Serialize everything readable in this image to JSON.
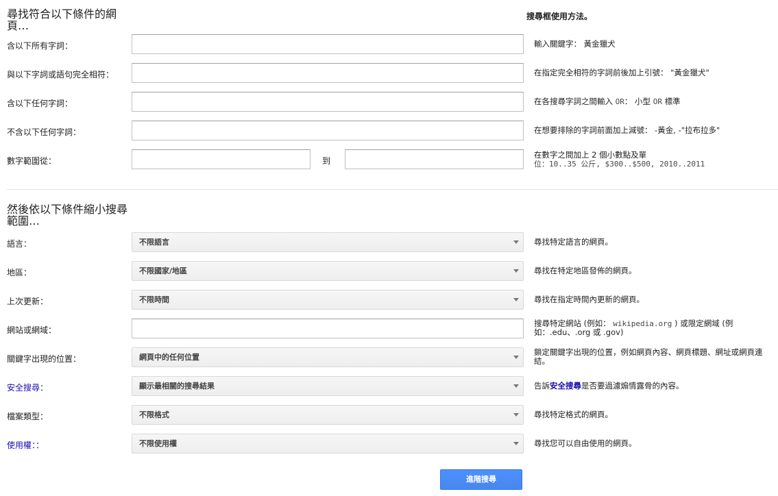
{
  "section1": {
    "title_line1": "尋找符合以下條件的網",
    "title_line2": "頁…",
    "help_header": "搜尋框使用方法。",
    "rows": [
      {
        "label": "含以下所有字詞：",
        "help": "輸入關鍵字： 黃金獵犬",
        "value": ""
      },
      {
        "label": "與以下字詞或語句完全相符：",
        "help": "在指定完全相符的字詞前後加上引號： \"黃金獵犬\"",
        "value": ""
      },
      {
        "label": "含以下任何字詞：",
        "help_prefix": "在各搜尋字詞之間輸入 ",
        "help_or1": "OR",
        "help_mid": "： 小型 ",
        "help_or2": "OR",
        "help_end": " 標準",
        "value": ""
      },
      {
        "label": "不含以下任何字詞：",
        "help": "在想要排除的字詞前面加上減號： -黃金, -\"拉布拉多\"",
        "value": ""
      }
    ],
    "range": {
      "label": "數字範圍從：",
      "to_label": "到",
      "from_value": "",
      "to_value": "",
      "help_line1": "在數字之間加上 2 個小數點及單",
      "help_line2": "位：10..35 公斤, $300..$500, 2010..2011"
    }
  },
  "section2": {
    "title_line1": "然後依以下條件縮小搜尋",
    "title_line2": "範圍…",
    "rows": [
      {
        "label": "語言：",
        "value": "不限語言",
        "help": "尋找特定語言的網頁。"
      },
      {
        "label": "地區：",
        "value": "不限國家/地區",
        "help": "尋找在特定地區發佈的網頁。"
      },
      {
        "label": "上次更新：",
        "value": "不限時間",
        "help": "尋找在指定時間內更新的網頁。"
      },
      {
        "label": "網站或網域：",
        "value": "",
        "help_line1_a": "搜尋特定網站 (例如： ",
        "help_line1_code": "wikipedia.org",
        "help_line1_b": " ) 或限定網域 (例",
        "help_line2": "如：.edu、.org 或 .gov)"
      },
      {
        "label": "關鍵字出現的位置：",
        "value": "網頁中的任何位置",
        "help_line1": "鎖定關鍵字出現的位置，例如網頁內容、網頁標題、網址或網頁連",
        "help_line2": "結。"
      },
      {
        "label": "安全搜尋：",
        "value": "顯示最相關的搜尋結果",
        "help_prefix": "告訴",
        "help_link": "安全搜尋",
        "help_suffix": "是否要過濾煽情露骨的內容。"
      },
      {
        "label": "檔案類型：",
        "value": "不限格式",
        "help": "尋找特定格式的網頁。"
      },
      {
        "label": "使用權：：",
        "value": "不限使用權",
        "help": "尋找您可以自由使用的網頁。"
      }
    ]
  },
  "submit_button": "進階搜尋",
  "colors": {
    "accent": "#4d90fe",
    "link": "#1a0dab"
  }
}
